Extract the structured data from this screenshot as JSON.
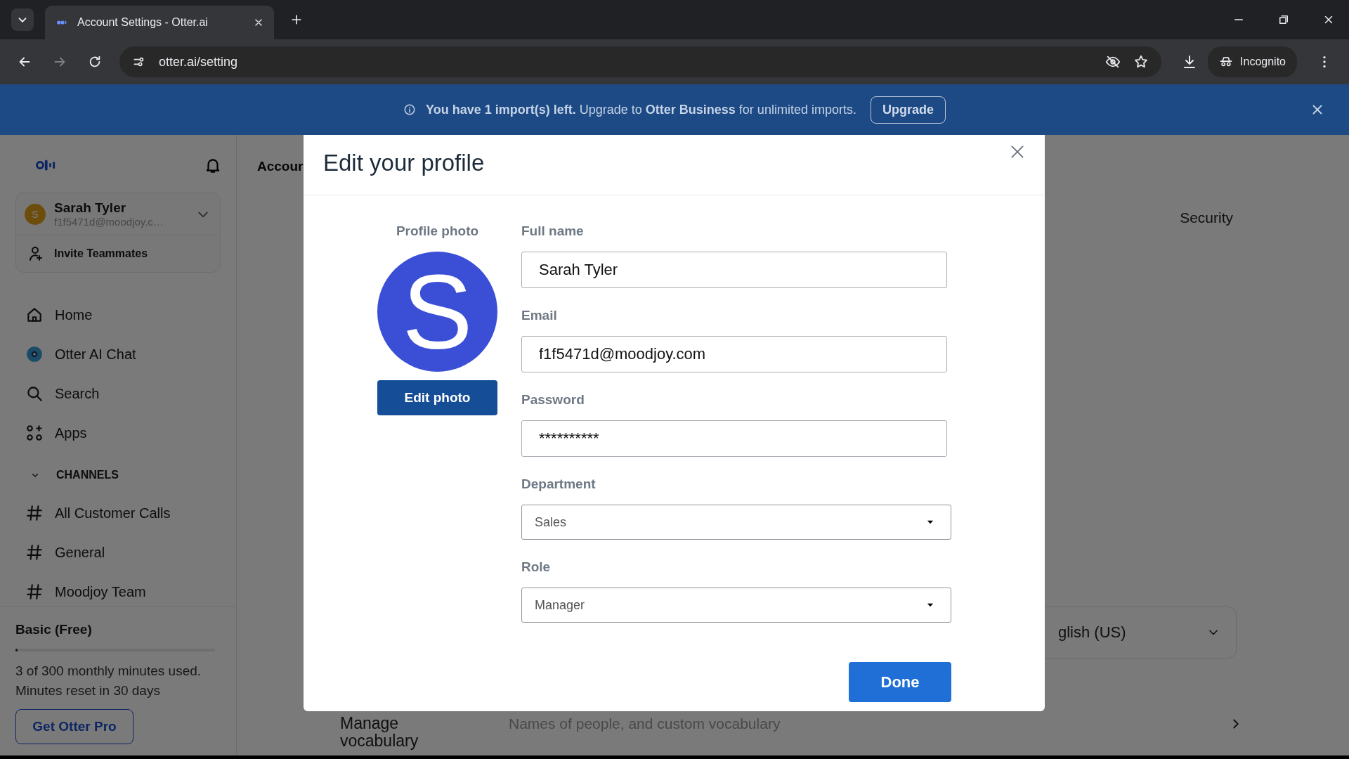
{
  "browser": {
    "tab_title": "Account Settings - Otter.ai",
    "url": "otter.ai/setting",
    "incognito_label": "Incognito"
  },
  "banner": {
    "message": "**You have 1 import(s) left.** Upgrade to **Otter Business** for unlimited imports.",
    "button": "Upgrade"
  },
  "sidebar": {
    "user": {
      "initial": "S",
      "name": "Sarah Tyler",
      "email": "f1f5471d@moodjoy.c…"
    },
    "invite": "Invite Teammates",
    "nav": [
      {
        "kind": "home",
        "label": "Home"
      },
      {
        "kind": "chat",
        "label": "Otter AI Chat"
      },
      {
        "kind": "search",
        "label": "Search"
      },
      {
        "kind": "apps",
        "label": "Apps"
      }
    ],
    "channels_heading": "CHANNELS",
    "channels_expanded": true,
    "channels": [
      "All Customer Calls",
      "General",
      "Moodjoy Team"
    ],
    "plan": {
      "name": "Basic (Free)",
      "level": 0.01,
      "usage": "3 of 300 monthly minutes used.",
      "reset": "Minutes reset in 30 days",
      "button": "Get Otter Pro"
    }
  },
  "main": {
    "title": "Accour",
    "tabs": [
      {
        "label": "Security"
      }
    ],
    "language": {
      "value": "glish (US)"
    },
    "vocabulary": {
      "label": "Manage vocabulary",
      "description": "Names of people, and custom vocabulary"
    }
  },
  "modal": {
    "title": "Edit your profile",
    "photo_label": "Profile photo",
    "avatar_letter": "S",
    "edit_photo": "Edit photo",
    "fields": [
      {
        "kind": "text",
        "label": "Full name",
        "value": "Sarah Tyler"
      },
      {
        "kind": "text",
        "label": "Email",
        "value": "f1f5471d@moodjoy.com"
      },
      {
        "kind": "text",
        "label": "Password",
        "value": "**********"
      },
      {
        "kind": "select",
        "label": "Department",
        "value": "Sales"
      },
      {
        "kind": "select",
        "label": "Role",
        "value": "Manager"
      }
    ],
    "done": "Done"
  }
}
